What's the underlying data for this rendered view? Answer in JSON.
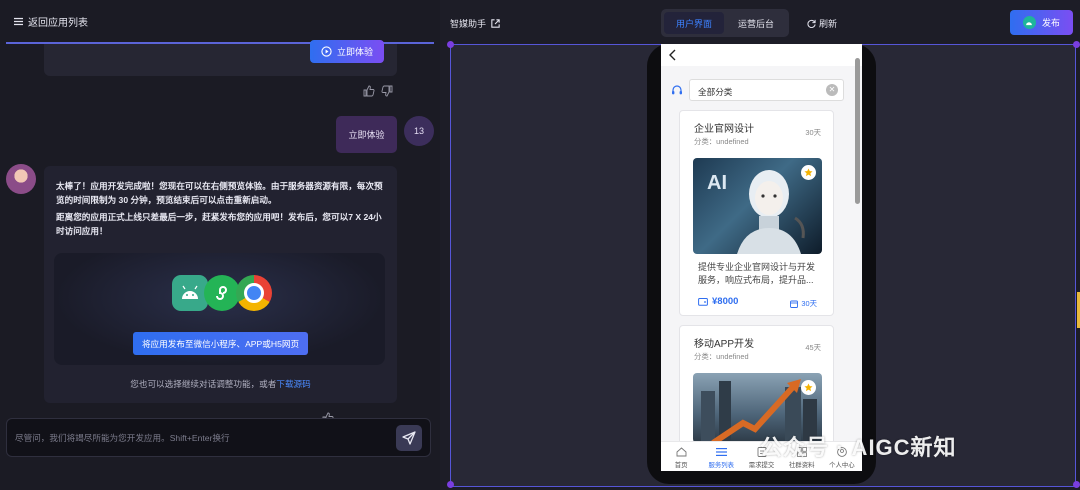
{
  "left_header": {
    "back_label": "返回应用列表"
  },
  "prev_message": {
    "try_button": "立即体验"
  },
  "user_message": {
    "text": "立即体验",
    "avatar_text": "13"
  },
  "bot_message": {
    "para1": "太棒了！应用开发完成啦！您现在可以在右侧预览体验。由于服务器资源有限，每次预览的时间限制为 30 分钟，预览结束后可以点击重新启动。",
    "para2": "距离您的应用正式上线只差最后一步，赶紧发布您的应用吧！发布后，您可以7 X 24小时访问应用！",
    "publish_apps_button": "将应用发布至微信小程序、APP或H5网页",
    "note_prefix": "您也可以选择继续对话调整功能，或者",
    "note_link": "下载源码"
  },
  "chat_input": {
    "placeholder": "尽管问，我们将竭尽所能为您开发应用。Shift+Enter换行"
  },
  "right_header": {
    "app_name": "智媒助手",
    "tab_user": "用户界面",
    "tab_admin": "运营后台",
    "refresh": "刷新",
    "publish": "发布"
  },
  "phone": {
    "search_text": "全部分类",
    "cards": [
      {
        "title": "企业官网设计",
        "category": "分类：undefined",
        "days": "30天",
        "image_text": "AI",
        "desc": "提供专业企业官网设计与开发服务，响应式布局，提升品...",
        "price": "¥8000",
        "price_days": "30天"
      },
      {
        "title": "移动APP开发",
        "category": "分类：undefined",
        "days": "45天"
      }
    ],
    "tabs": [
      "首页",
      "服务列表",
      "需求提交",
      "社群资料",
      "个人中心"
    ]
  },
  "watermark": "公众号 · AIGC新知",
  "colors": {
    "accent": "#2f6ef0",
    "gradient_end": "#7b4ef2",
    "user_bubble": "#3e2a59",
    "frame_border": "#5656d8"
  }
}
